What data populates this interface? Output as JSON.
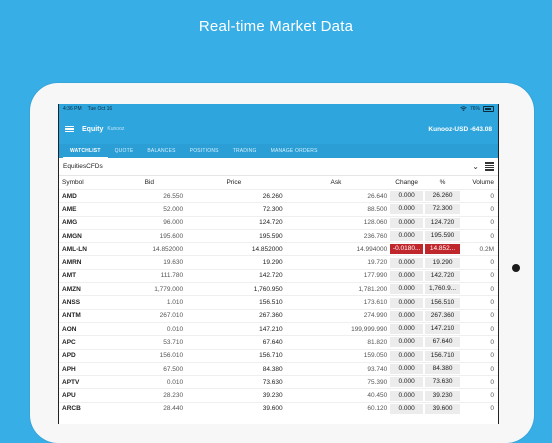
{
  "headline": "Real-time Market Data",
  "status_bar": {
    "time": "4:36 PM",
    "date": "Tue Oct 16",
    "battery": "76%"
  },
  "app": {
    "title": "Equity",
    "subtitle": "Kunooz",
    "account": "Kunooz-USD -643.08"
  },
  "tabs": [
    "WATCHLIST",
    "QUOTE",
    "BALANCES",
    "POSITIONS",
    "TRADING",
    "MANAGE ORDERS"
  ],
  "active_tab": "WATCHLIST",
  "filter": {
    "selected": "EquitiesCFDs"
  },
  "table": {
    "headers": [
      "Symbol",
      "Bid",
      "Price",
      "Ask",
      "Change",
      "%",
      "Volume"
    ],
    "rows": [
      {
        "symbol": "AMD",
        "bid": "26.550",
        "price": "26.260",
        "ask": "26.640",
        "change": "0.000",
        "pct": "26.260",
        "volume": "0"
      },
      {
        "symbol": "AME",
        "bid": "52.000",
        "price": "72.300",
        "ask": "88.500",
        "change": "0.000",
        "pct": "72.300",
        "volume": "0"
      },
      {
        "symbol": "AMG",
        "bid": "96.000",
        "price": "124.720",
        "ask": "128.060",
        "change": "0.000",
        "pct": "124.720",
        "volume": "0"
      },
      {
        "symbol": "AMGN",
        "bid": "195.600",
        "price": "195.590",
        "ask": "236.760",
        "change": "0.000",
        "pct": "195.590",
        "volume": "0"
      },
      {
        "symbol": "AML-LN",
        "bid": "14.852000",
        "price": "14.852000",
        "ask": "14.994000",
        "change": "-0.0180...",
        "pct": "14.852...",
        "volume": "0.2M",
        "negative": true
      },
      {
        "symbol": "AMRN",
        "bid": "19.630",
        "price": "19.290",
        "ask": "19.720",
        "change": "0.000",
        "pct": "19.290",
        "volume": "0"
      },
      {
        "symbol": "AMT",
        "bid": "111.780",
        "price": "142.720",
        "ask": "177.990",
        "change": "0.000",
        "pct": "142.720",
        "volume": "0"
      },
      {
        "symbol": "AMZN",
        "bid": "1,779.000",
        "price": "1,760.950",
        "ask": "1,781.200",
        "change": "0.000",
        "pct": "1,760.9...",
        "volume": "0"
      },
      {
        "symbol": "ANSS",
        "bid": "1.010",
        "price": "156.510",
        "ask": "173.610",
        "change": "0.000",
        "pct": "156.510",
        "volume": "0"
      },
      {
        "symbol": "ANTM",
        "bid": "267.010",
        "price": "267.360",
        "ask": "274.990",
        "change": "0.000",
        "pct": "267.360",
        "volume": "0"
      },
      {
        "symbol": "AON",
        "bid": "0.010",
        "price": "147.210",
        "ask": "199,999.990",
        "change": "0.000",
        "pct": "147.210",
        "volume": "0"
      },
      {
        "symbol": "APC",
        "bid": "53.710",
        "price": "67.640",
        "ask": "81.820",
        "change": "0.000",
        "pct": "67.640",
        "volume": "0"
      },
      {
        "symbol": "APD",
        "bid": "156.010",
        "price": "156.710",
        "ask": "159.050",
        "change": "0.000",
        "pct": "156.710",
        "volume": "0"
      },
      {
        "symbol": "APH",
        "bid": "67.500",
        "price": "84.380",
        "ask": "93.740",
        "change": "0.000",
        "pct": "84.380",
        "volume": "0"
      },
      {
        "symbol": "APTV",
        "bid": "0.010",
        "price": "73.630",
        "ask": "75.390",
        "change": "0.000",
        "pct": "73.630",
        "volume": "0"
      },
      {
        "symbol": "APU",
        "bid": "28.230",
        "price": "39.230",
        "ask": "40.450",
        "change": "0.000",
        "pct": "39.230",
        "volume": "0"
      },
      {
        "symbol": "ARCB",
        "bid": "28.440",
        "price": "39.600",
        "ask": "60.120",
        "change": "0.000",
        "pct": "39.600",
        "volume": "0"
      }
    ]
  },
  "colors": {
    "background": "#38aee6",
    "app_bar": "#2fa5dd",
    "negative": "#c0272d"
  },
  "icons": [
    "menu-icon",
    "chevron-down-icon",
    "list-view-icon",
    "battery-icon",
    "wifi-icon"
  ]
}
